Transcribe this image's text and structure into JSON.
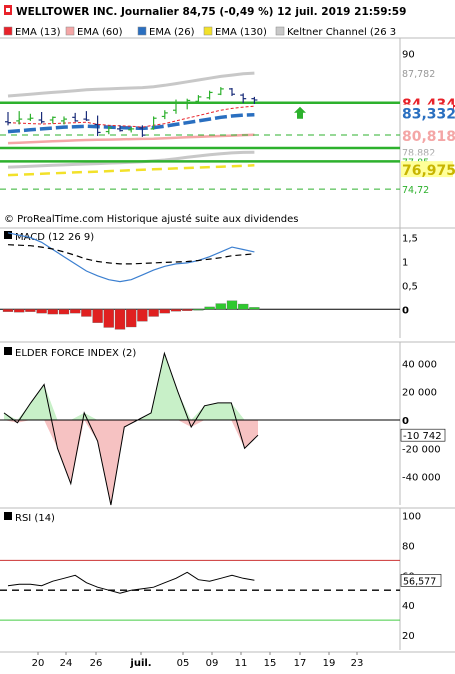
{
  "header": {
    "title": "WELLTOWER INC. Journalier 84,75 (-0,49 %) 12 juil. 2019 21:59:59"
  },
  "legend": [
    {
      "label": "EMA (13)",
      "color": "#e8222a"
    },
    {
      "label": "EMA (60)",
      "color": "#f4a6a6"
    },
    {
      "label": "EMA (26)",
      "color": "#2a6fc0"
    },
    {
      "label": "EMA (130)",
      "color": "#f2e12a"
    },
    {
      "label": "Keltner Channel (26 3",
      "color": "#c8c8c8"
    }
  ],
  "watermark": "© ProRealTime.com Historique ajusté suite aux dividendes",
  "colors": {
    "grid": "#bdbdbd",
    "green_line": "#2db12d",
    "dashed_green": "#2db12d",
    "up_candle": "#2db12d",
    "down_candle": "#1a2d7a",
    "macd_line": "#3b7fd0",
    "macd_pos": "#2fc82f",
    "macd_neg": "#e02020",
    "force_pos_fill": "#c8f0c8",
    "force_neg_fill": "#f6c2c2",
    "rsi_line": "#000000",
    "rsi_upper": "#cc3333",
    "rsi_lower": "#44cc44"
  },
  "chart_data": [
    {
      "type": "candlestick",
      "name": "price",
      "ylim": [
        73.5,
        91.5
      ],
      "yticks": [
        "90",
        "87,782",
        "87,782"
      ],
      "x_labels": [
        "20",
        "24",
        "26",
        "juil.",
        "05",
        "09",
        "11",
        "15",
        "17",
        "19",
        "23"
      ],
      "candles": [
        {
          "o": 82.3,
          "h": 83.4,
          "l": 81.9,
          "c": 82.2
        },
        {
          "o": 82.4,
          "h": 83.5,
          "l": 82.0,
          "c": 82.6
        },
        {
          "o": 82.6,
          "h": 83.2,
          "l": 82.4,
          "c": 82.7
        },
        {
          "o": 82.5,
          "h": 83.4,
          "l": 82.1,
          "c": 82.3
        },
        {
          "o": 82.5,
          "h": 82.9,
          "l": 82.1,
          "c": 82.8
        },
        {
          "o": 82.4,
          "h": 82.9,
          "l": 82.0,
          "c": 82.6
        },
        {
          "o": 82.8,
          "h": 83.3,
          "l": 82.3,
          "c": 82.4
        },
        {
          "o": 82.6,
          "h": 83.5,
          "l": 82.4,
          "c": 82.5
        },
        {
          "o": 82.0,
          "h": 83.0,
          "l": 80.7,
          "c": 81.1
        },
        {
          "o": 81.2,
          "h": 81.8,
          "l": 80.9,
          "c": 81.6
        },
        {
          "o": 81.5,
          "h": 81.9,
          "l": 81.2,
          "c": 81.3
        },
        {
          "o": 81.4,
          "h": 81.7,
          "l": 81.1,
          "c": 81.5
        },
        {
          "o": 81.6,
          "h": 81.9,
          "l": 80.6,
          "c": 80.8
        },
        {
          "o": 81.5,
          "h": 82.9,
          "l": 81.4,
          "c": 82.7
        },
        {
          "o": 82.9,
          "h": 83.6,
          "l": 82.6,
          "c": 83.3
        },
        {
          "o": 83.6,
          "h": 84.8,
          "l": 83.2,
          "c": 84.4
        },
        {
          "o": 84.5,
          "h": 84.9,
          "l": 83.7,
          "c": 84.7
        },
        {
          "o": 84.6,
          "h": 85.3,
          "l": 84.3,
          "c": 85.1
        },
        {
          "o": 85.0,
          "h": 85.8,
          "l": 84.8,
          "c": 85.6
        },
        {
          "o": 85.4,
          "h": 86.2,
          "l": 85.3,
          "c": 86.0
        },
        {
          "o": 86.0,
          "h": 86.1,
          "l": 85.2,
          "c": 85.4
        },
        {
          "o": 85.3,
          "h": 85.5,
          "l": 84.4,
          "c": 84.9
        },
        {
          "o": 84.9,
          "h": 85.1,
          "l": 84.3,
          "c": 84.75
        }
      ],
      "ema13": [
        82.2,
        82.15,
        82.1,
        82.05,
        82.1,
        82.15,
        82.2,
        82.25,
        82.0,
        81.9,
        81.85,
        81.8,
        81.7,
        81.9,
        82.1,
        82.4,
        82.7,
        83.0,
        83.3,
        83.6,
        83.8,
        83.95,
        84.05
      ],
      "ema26": [
        81.2,
        81.3,
        81.4,
        81.5,
        81.6,
        81.7,
        81.75,
        81.8,
        81.75,
        81.7,
        81.65,
        81.6,
        81.55,
        81.65,
        81.8,
        82.0,
        82.2,
        82.4,
        82.6,
        82.8,
        82.95,
        83.05,
        83.1
      ],
      "ema60": [
        79.9,
        79.95,
        80.0,
        80.05,
        80.1,
        80.15,
        80.2,
        80.25,
        80.27,
        80.3,
        80.32,
        80.35,
        80.37,
        80.4,
        80.45,
        80.5,
        80.55,
        80.6,
        80.65,
        80.7,
        80.75,
        80.8,
        80.85
      ],
      "ema130": [
        76.3,
        76.35,
        76.4,
        76.45,
        76.5,
        76.55,
        76.6,
        76.65,
        76.7,
        76.75,
        76.8,
        76.85,
        76.9,
        76.95,
        77.0,
        77.05,
        77.1,
        77.15,
        77.2,
        77.25,
        77.3,
        77.35,
        77.4
      ],
      "keltner_upper": [
        85.2,
        85.3,
        85.4,
        85.5,
        85.6,
        85.7,
        85.8,
        85.9,
        85.95,
        86.0,
        86.05,
        86.1,
        86.15,
        86.25,
        86.4,
        86.6,
        86.8,
        87.0,
        87.2,
        87.4,
        87.55,
        87.7,
        87.78
      ],
      "keltner_lower": [
        77.2,
        77.25,
        77.3,
        77.35,
        77.4,
        77.45,
        77.5,
        77.55,
        77.6,
        77.65,
        77.7,
        77.75,
        77.8,
        77.9,
        78.0,
        78.15,
        78.3,
        78.45,
        78.6,
        78.7,
        78.8,
        78.85,
        78.88
      ],
      "hlines": [
        {
          "value": 84.434,
          "label": "84,434",
          "style": "solid",
          "color": "#2db12d"
        },
        {
          "value": 80.818,
          "label": "80,818",
          "style": "dashed",
          "color": "#2db12d"
        },
        {
          "value": 79.35,
          "label": "",
          "style": "solid",
          "color": "#2db12d"
        },
        {
          "value": 77.85,
          "label": "77,85",
          "style": "solid",
          "color": "#2db12d"
        },
        {
          "value": 74.72,
          "label": "74,72",
          "style": "dashed",
          "color": "#2db12d"
        }
      ],
      "price_labels": [
        {
          "value": 87.782,
          "text": "87,782",
          "bg": "#ffffff",
          "fg": "#999999"
        },
        {
          "value": 84.434,
          "text": "84,434",
          "bg": "#ffffff",
          "fg": "#e8222a"
        },
        {
          "value": 83.332,
          "text": "83,332",
          "bg": "#ffffff",
          "fg": "#2a6fc0"
        },
        {
          "value": 80.818,
          "text": "80,818",
          "bg": "#ffffff",
          "fg": "#f4a6a6"
        },
        {
          "value": 78.882,
          "text": "78,882",
          "bg": "#ffffff",
          "fg": "#aaaaaa"
        },
        {
          "value": 77.85,
          "text": "77,85",
          "bg": "#ffffff",
          "fg": "#2db12d"
        },
        {
          "value": 76.975,
          "text": "76,975",
          "bg": "#ffff99",
          "fg": "#c8b400"
        },
        {
          "value": 74.72,
          "text": "74,72",
          "bg": "#ffffff",
          "fg": "#2db12d"
        }
      ],
      "signal_arrow": {
        "direction": "up",
        "at": "15",
        "color": "#2db12d"
      }
    },
    {
      "type": "macd",
      "title": "MACD (12 26 9)",
      "ylim": [
        -0.6,
        1.7
      ],
      "yticks": [
        1.5,
        1,
        0.5,
        0
      ],
      "ytick_labels": [
        "1,5",
        "1",
        "0,5",
        "0"
      ],
      "macd": [
        1.6,
        1.55,
        1.5,
        1.4,
        1.25,
        1.1,
        0.95,
        0.8,
        0.7,
        0.62,
        0.58,
        0.62,
        0.72,
        0.82,
        0.9,
        0.95,
        0.97,
        1.02,
        1.1,
        1.2,
        1.3,
        1.25,
        1.2
      ],
      "signal": [
        1.35,
        1.34,
        1.33,
        1.3,
        1.26,
        1.2,
        1.13,
        1.05,
        1.0,
        0.97,
        0.95,
        0.95,
        0.96,
        0.97,
        0.98,
        0.99,
        1.0,
        1.02,
        1.05,
        1.08,
        1.12,
        1.14,
        1.16
      ],
      "histogram": [
        -0.05,
        -0.06,
        -0.05,
        -0.08,
        -0.1,
        -0.1,
        -0.08,
        -0.15,
        -0.28,
        -0.38,
        -0.42,
        -0.37,
        -0.25,
        -0.15,
        -0.08,
        -0.04,
        -0.03,
        0.0,
        0.05,
        0.12,
        0.18,
        0.11,
        0.04
      ]
    },
    {
      "type": "force_index",
      "title": "ELDER FORCE INDEX (2)",
      "ylim": [
        -60000,
        55000
      ],
      "yticks": [
        40000,
        20000,
        0,
        -20000,
        -40000
      ],
      "ytick_labels": [
        "40 000",
        "20 000",
        "0",
        "-20 000",
        "-40 000"
      ],
      "current_label": "-10 742",
      "values": [
        5000,
        -2000,
        12000,
        25000,
        -20000,
        -45000,
        5000,
        -15000,
        -60000,
        -5000,
        0,
        5000,
        47000,
        20000,
        -5000,
        10000,
        12000,
        12000,
        -20000,
        -10742
      ]
    },
    {
      "type": "rsi",
      "title": "RSI (14)",
      "ylim": [
        10,
        105
      ],
      "yticks": [
        100,
        80,
        60,
        40,
        20
      ],
      "ytick_labels": [
        "100",
        "80",
        "60",
        "40",
        "20"
      ],
      "upper": 70,
      "lower": 30,
      "reference": 50,
      "current_label": "56,577",
      "values": [
        53,
        54,
        54,
        53,
        56,
        58,
        60,
        55,
        52,
        50,
        48,
        50,
        51,
        52,
        55,
        58,
        62,
        57,
        56,
        58,
        60,
        58,
        56.6
      ]
    }
  ]
}
